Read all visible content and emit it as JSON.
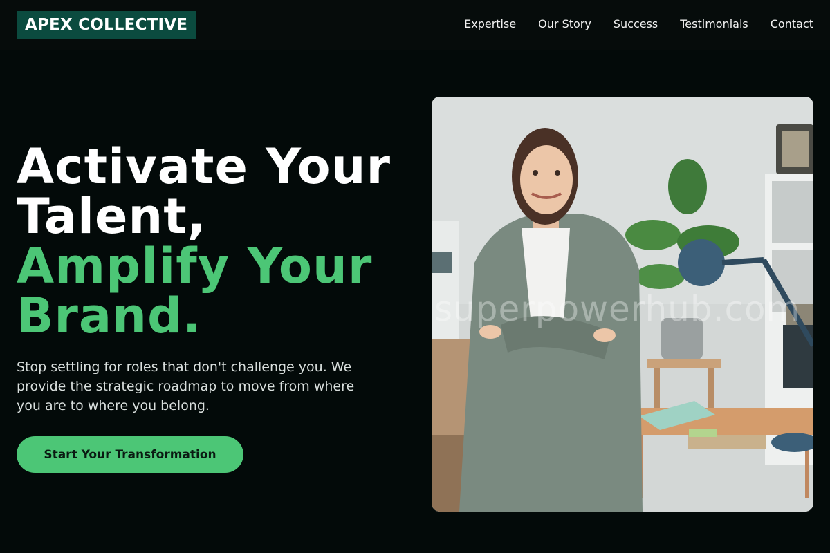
{
  "brand": {
    "name": "APEX COLLECTIVE"
  },
  "nav": {
    "links": [
      "Expertise",
      "Our Story",
      "Success",
      "Testimonials",
      "Contact"
    ]
  },
  "hero": {
    "headline_lines": [
      "Activate Your",
      "Talent,"
    ],
    "accent_lines": [
      "Amplify Your",
      "Brand."
    ],
    "subtext": "Stop settling for roles that don't challenge you. We provide the strategic roadmap to move from where you are to where you belong.",
    "cta_label": "Start Your Transformation"
  },
  "photo": {
    "watermark": "superpowerhub.com"
  },
  "colors": {
    "background": "#030a09",
    "logo_bg": "#0b4b3f",
    "accent": "#4cc676"
  }
}
